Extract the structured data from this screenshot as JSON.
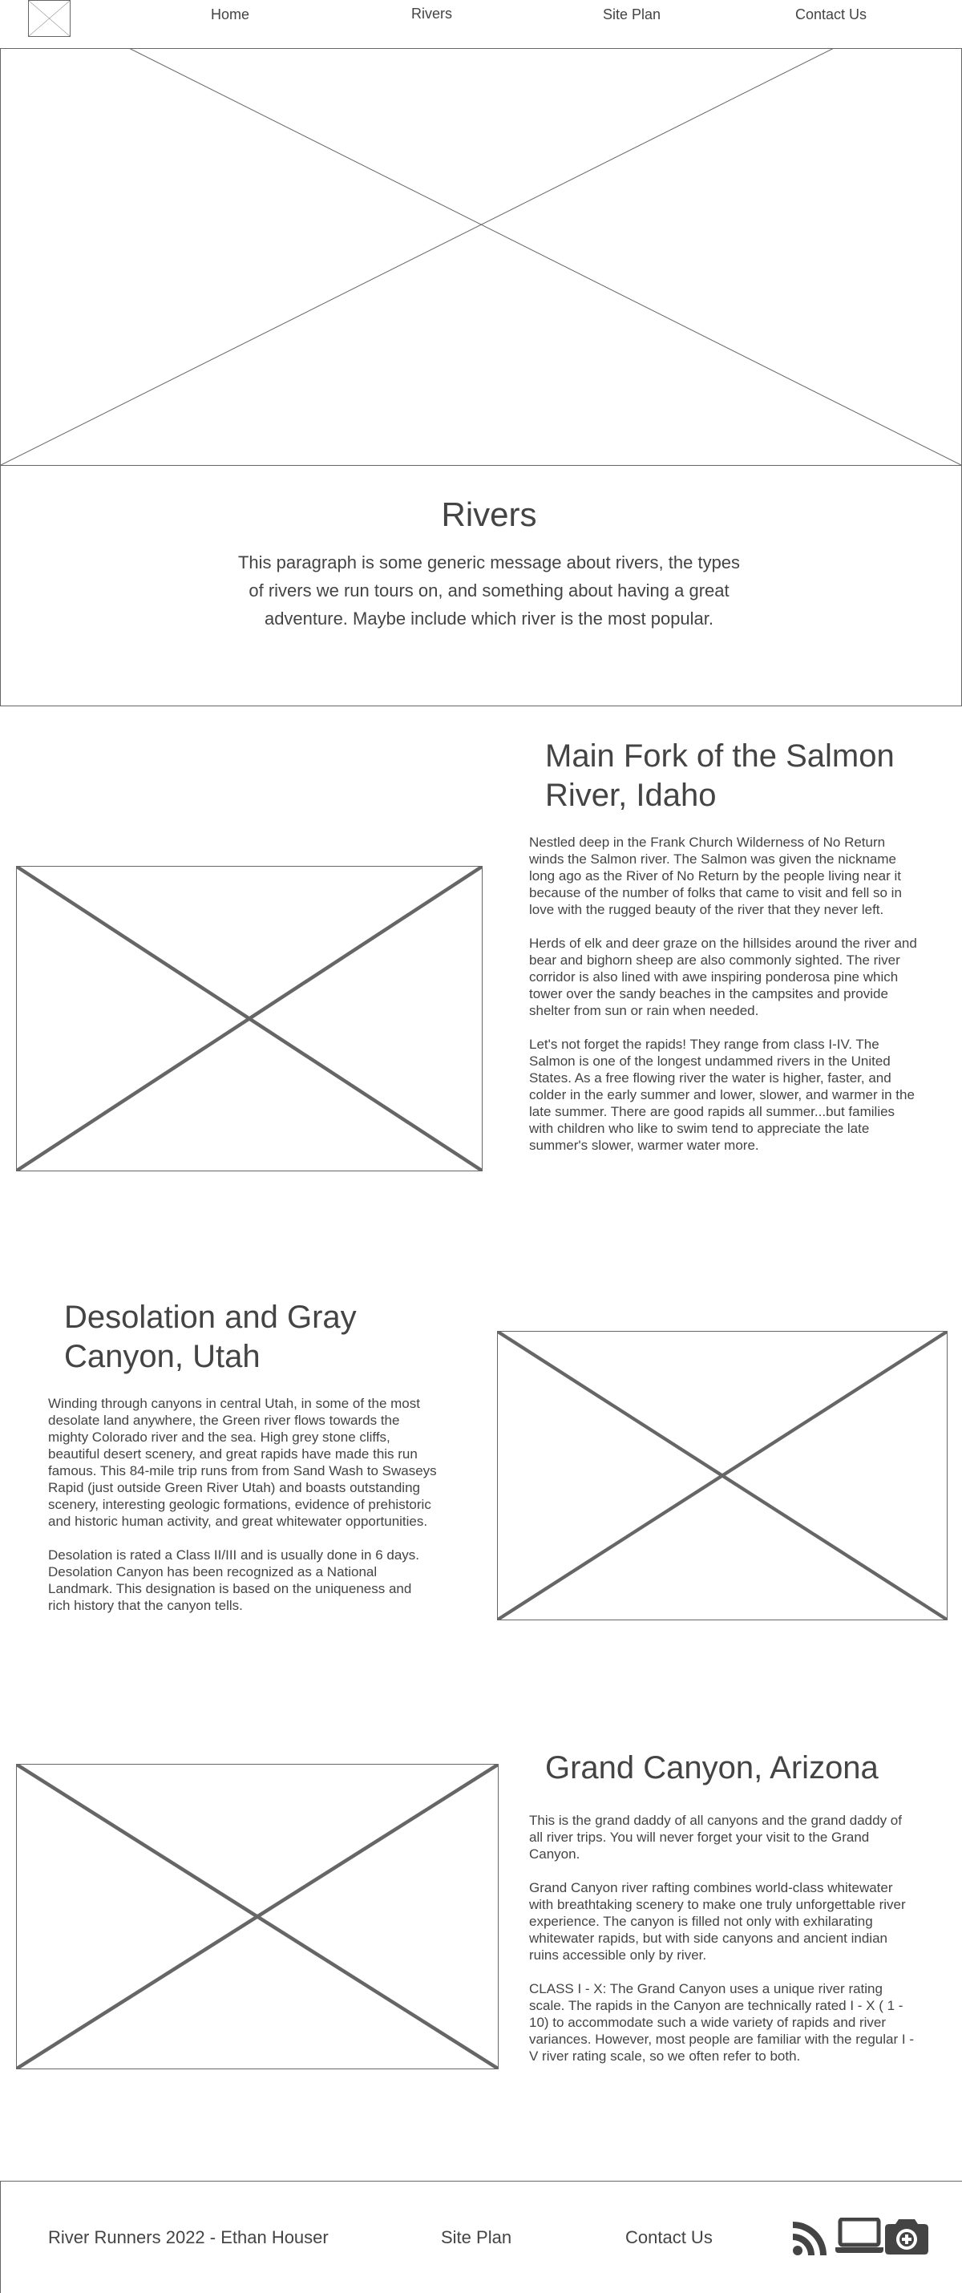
{
  "nav": {
    "links": [
      "Home",
      "Rivers",
      "Site Plan",
      "Contact Us"
    ]
  },
  "intro": {
    "title": "Rivers",
    "text": "This paragraph is some generic message about rivers, the types of rivers we run tours on, and something about having a great adventure. Maybe include which river is the most popular."
  },
  "sections": [
    {
      "title": "Main Fork of the Salmon River, Idaho",
      "paragraphs": [
        "Nestled deep in the Frank Church Wilderness of No Return winds the Salmon river. The Salmon was given the nickname long ago as the River of No Return by the people living near it because of the number of folks that came to visit and fell so in love with the rugged beauty of the river that they never left.",
        "Herds of elk and deer graze on the hillsides around the river and bear and bighorn sheep are also commonly sighted. The river corridor is also lined with awe inspiring ponderosa pine which tower over the sandy beaches in the campsites and provide shelter from sun or rain when needed.",
        "Let's not forget the rapids! They range from class I-IV. The Salmon is one of the longest undammed rivers in the United States. As a free flowing river the water is higher, faster, and colder in the early summer and lower, slower, and warmer in the late summer. There are good rapids all summer...but families with children who like to swim tend to appreciate the late summer's slower, warmer water more."
      ]
    },
    {
      "title": "Desolation and Gray Canyon, Utah",
      "paragraphs": [
        "Winding through canyons in central Utah, in some of the most desolate land anywhere, the Green river flows towards the mighty Colorado river and the sea. High grey stone cliffs, beautiful desert scenery, and great rapids have made this run famous. This 84-mile trip runs from from Sand Wash to Swaseys Rapid (just outside Green River Utah) and boasts outstanding scenery, interesting geologic formations, evidence of prehistoric and historic human activity, and great whitewater opportunities.",
        "Desolation is rated a Class II/III and is usually done in 6 days. Desolation Canyon has been recognized as a National Landmark. This designation is based on the uniqueness and rich history that the canyon tells."
      ]
    },
    {
      "title": "Grand Canyon, Arizona",
      "paragraphs": [
        "This is the grand daddy of all canyons and the grand daddy of all river trips. You will never forget your visit to the Grand Canyon.",
        "Grand Canyon river rafting combines world-class whitewater with breathtaking scenery to make one truly unforgettable river experience. The canyon is filled not only with exhilarating whitewater rapids, but with side canyons and ancient indian ruins accessible only by river.",
        "CLASS I - X: The Grand Canyon uses a unique river rating scale. The rapids in the Canyon are technically rated I - X ( 1 - 10) to accommodate such a wide variety of rapids and river variances. However, most people are familiar with the regular I - V river rating scale, so we often refer to both."
      ]
    }
  ],
  "footer": {
    "credit": "River Runners 2022 - Ethan Houser",
    "site_plan": "Site Plan",
    "contact": "Contact Us",
    "icons": [
      "rss-icon",
      "laptop-icon",
      "camera-icon"
    ]
  },
  "colors": {
    "text": "#444444",
    "lines": "#666666",
    "background": "#ffffff"
  }
}
